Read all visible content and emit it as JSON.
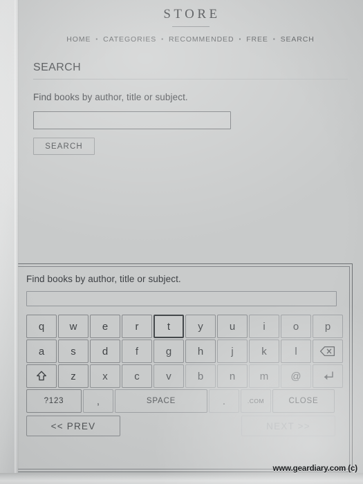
{
  "header": {
    "store_title": "STORE",
    "nav_items": [
      "HOME",
      "CATEGORIES",
      "RECOMMENDED",
      "FREE",
      "SEARCH"
    ],
    "nav_separator": "▪"
  },
  "page": {
    "section_title": "SEARCH",
    "prompt_label": "Find books by author, title or subject.",
    "search_value": "",
    "search_button_label": "SEARCH"
  },
  "keyboard_panel": {
    "prompt_label": "Find books by author, title or subject.",
    "input_value": "",
    "rows": [
      {
        "keys": [
          {
            "label": "q",
            "name": "key-q",
            "focused": false,
            "dim": 0
          },
          {
            "label": "w",
            "name": "key-w",
            "focused": false,
            "dim": 0
          },
          {
            "label": "e",
            "name": "key-e",
            "focused": false,
            "dim": 0
          },
          {
            "label": "r",
            "name": "key-r",
            "focused": false,
            "dim": 0
          },
          {
            "label": "t",
            "name": "key-t",
            "focused": true,
            "dim": 0
          },
          {
            "label": "y",
            "name": "key-y",
            "focused": false,
            "dim": 1
          },
          {
            "label": "u",
            "name": "key-u",
            "focused": false,
            "dim": 1
          },
          {
            "label": "i",
            "name": "key-i",
            "focused": false,
            "dim": 2
          },
          {
            "label": "o",
            "name": "key-o",
            "focused": false,
            "dim": 2
          },
          {
            "label": "p",
            "name": "key-p",
            "focused": false,
            "dim": 2
          }
        ]
      },
      {
        "keys": [
          {
            "label": "a",
            "name": "key-a",
            "focused": false,
            "dim": 0
          },
          {
            "label": "s",
            "name": "key-s",
            "focused": false,
            "dim": 0
          },
          {
            "label": "d",
            "name": "key-d",
            "focused": false,
            "dim": 0
          },
          {
            "label": "f",
            "name": "key-f",
            "focused": false,
            "dim": 1
          },
          {
            "label": "g",
            "name": "key-g",
            "focused": false,
            "dim": 1
          },
          {
            "label": "h",
            "name": "key-h",
            "focused": false,
            "dim": 1
          },
          {
            "label": "j",
            "name": "key-j",
            "focused": false,
            "dim": 2
          },
          {
            "label": "k",
            "name": "key-k",
            "focused": false,
            "dim": 2
          },
          {
            "label": "l",
            "name": "key-l",
            "focused": false,
            "dim": 2
          },
          {
            "label": "",
            "name": "key-backspace",
            "icon": "backspace-icon",
            "focused": false,
            "dim": 2
          }
        ]
      },
      {
        "keys": [
          {
            "label": "",
            "name": "key-shift",
            "icon": "shift-icon",
            "focused": false,
            "dim": 0
          },
          {
            "label": "z",
            "name": "key-z",
            "focused": false,
            "dim": 0
          },
          {
            "label": "x",
            "name": "key-x",
            "focused": false,
            "dim": 1
          },
          {
            "label": "c",
            "name": "key-c",
            "focused": false,
            "dim": 1
          },
          {
            "label": "v",
            "name": "key-v",
            "focused": false,
            "dim": 2
          },
          {
            "label": "b",
            "name": "key-b",
            "focused": false,
            "dim": 3
          },
          {
            "label": "n",
            "name": "key-n",
            "focused": false,
            "dim": 3
          },
          {
            "label": "m",
            "name": "key-m",
            "focused": false,
            "dim": 4
          },
          {
            "label": "@",
            "name": "key-at",
            "focused": false,
            "dim": 4
          },
          {
            "label": "",
            "name": "key-enter",
            "icon": "enter-icon",
            "focused": false,
            "dim": 3
          }
        ]
      },
      {
        "keys": [
          {
            "label": "?123",
            "name": "key-numbers",
            "size": "k-num",
            "style": "sm",
            "focused": false,
            "dim": 0
          },
          {
            "label": ",",
            "name": "key-comma",
            "size": "k-comma",
            "focused": false,
            "dim": 2
          },
          {
            "label": "SPACE",
            "name": "key-space",
            "size": "k-space",
            "style": "sm",
            "focused": false,
            "dim": 2
          },
          {
            "label": ".",
            "name": "key-period",
            "size": "k-dot",
            "focused": false,
            "dim": 4
          },
          {
            "label": ".COM",
            "name": "key-dotcom",
            "size": "k-com",
            "style": "xs",
            "focused": false,
            "dim": 4
          },
          {
            "label": "CLOSE",
            "name": "key-close",
            "size": "k-close",
            "style": "sm",
            "focused": false,
            "dim": 3
          }
        ]
      }
    ],
    "prev_label": "<< PREV",
    "next_label": "NEXT >>",
    "next_disabled": true
  },
  "watermark": "www.geardiary.com (c)",
  "colors": {
    "screen_background": "#c8caca",
    "ink": "#3f4245",
    "border": "#85888b",
    "focus_border": "#44484b"
  }
}
